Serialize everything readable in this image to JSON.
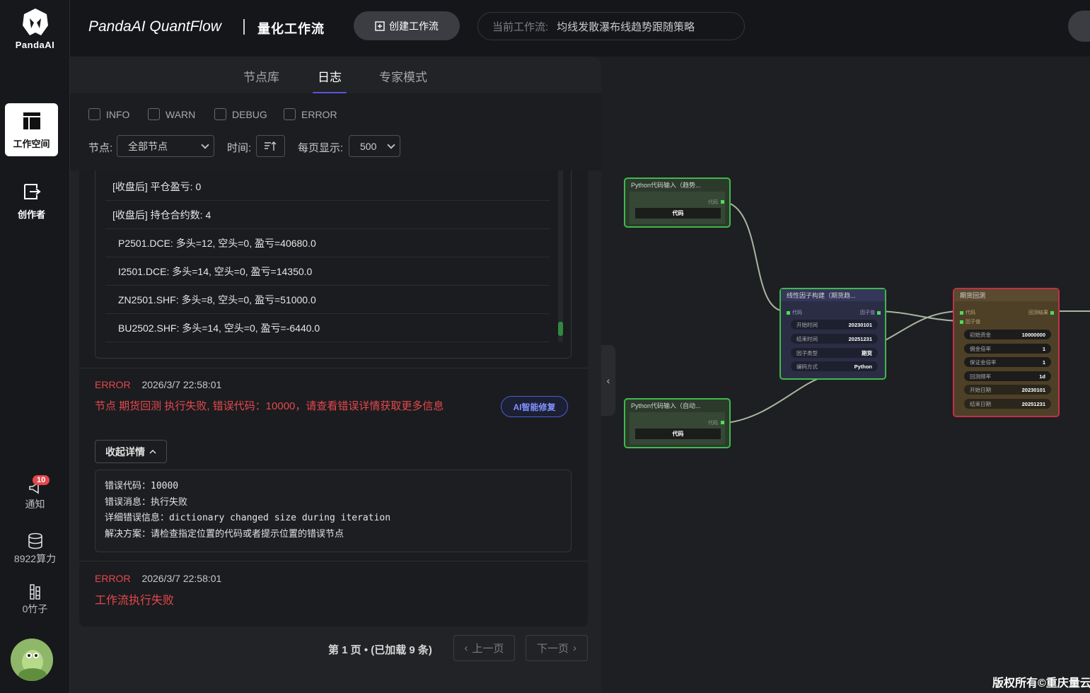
{
  "sidebar": {
    "logo_text": "PandaAI",
    "workspace_label": "工作空间",
    "creator_label": "创作者",
    "notify_label": "通知",
    "notify_badge": "10",
    "compute_label": "8922算力",
    "bamboo_label": "0竹子"
  },
  "header": {
    "title": "PandaAI QuantFlow",
    "subtitle": "量化工作流",
    "create_button": "创建工作流",
    "current_flow_key": "当前工作流:",
    "current_flow_value": "均线发散瀑布线趋势跟随策略"
  },
  "tabs": [
    {
      "label": "节点库"
    },
    {
      "label": "日志"
    },
    {
      "label": "专家模式"
    }
  ],
  "filters": {
    "levels": [
      "INFO",
      "WARN",
      "DEBUG",
      "ERROR"
    ],
    "node_label": "节点:",
    "node_value": "全部节点",
    "time_label": "时间:",
    "per_page_label": "每页显示:",
    "per_page_value": "500"
  },
  "logs": {
    "lines": [
      "[收盘后] 平仓盈亏: 0",
      "[收盘后] 持仓合约数: 4",
      "P2501.DCE: 多头=12, 空头=0, 盈亏=40680.0",
      "I2501.DCE: 多头=14, 空头=0, 盈亏=14350.0",
      "ZN2501.SHF: 多头=8, 空头=0, 盈亏=51000.0",
      "BU2502.SHF: 多头=14, 空头=0, 盈亏=-6440.0"
    ],
    "entry1": {
      "level": "ERROR",
      "time": "2026/3/7 22:58:01",
      "message": "节点 期货回测 执行失败, 错误代码：10000，请查看错误详情获取更多信息",
      "ai_fix": "AI智能修复",
      "collapse": "收起详情",
      "details": [
        "错误代码：10000",
        "错误消息：执行失败",
        "详细错误信息：dictionary changed size during iteration",
        "解决方案：请检查指定位置的代码或者提示位置的错误节点"
      ]
    },
    "entry2": {
      "level": "ERROR",
      "time": "2026/3/7 22:58:01",
      "message": "工作流执行失败"
    }
  },
  "pager": {
    "info": "第 1 页 • (已加载 9 条)",
    "prev": "上一页",
    "next": "下一页"
  },
  "graph": {
    "node1": {
      "title": "Python代码输入（趋势...",
      "port": "代码",
      "field": "代码"
    },
    "node2": {
      "title": "Python代码输入（自动...",
      "port": "代码",
      "field": "代码"
    },
    "node3": {
      "title": "线性因子构建（期货趋...",
      "in": "代码",
      "out": "因子值",
      "rows": [
        {
          "k": "开始时间",
          "v": "20230101"
        },
        {
          "k": "结束时间",
          "v": "20251231"
        },
        {
          "k": "因子类型",
          "v": "期货"
        },
        {
          "k": "编码方式",
          "v": "Python"
        }
      ]
    },
    "node4": {
      "title": "期货回测",
      "in1": "代码",
      "in2": "因子值",
      "out": "回测结果",
      "rows": [
        {
          "k": "初始资金",
          "v": "10000000"
        },
        {
          "k": "佣金倍率",
          "v": "1"
        },
        {
          "k": "保证金倍率",
          "v": "1"
        },
        {
          "k": "回测频率",
          "v": "1d"
        },
        {
          "k": "开始日期",
          "v": "20230101"
        },
        {
          "k": "结束日期",
          "v": "20251231"
        }
      ]
    }
  },
  "footer": {
    "copyright": "版权所有©重庆量云"
  },
  "colors": {
    "accent": "#5b54d8",
    "error": "#e5484d",
    "node_green": "#3fb94c",
    "node_red": "#c0304a"
  }
}
